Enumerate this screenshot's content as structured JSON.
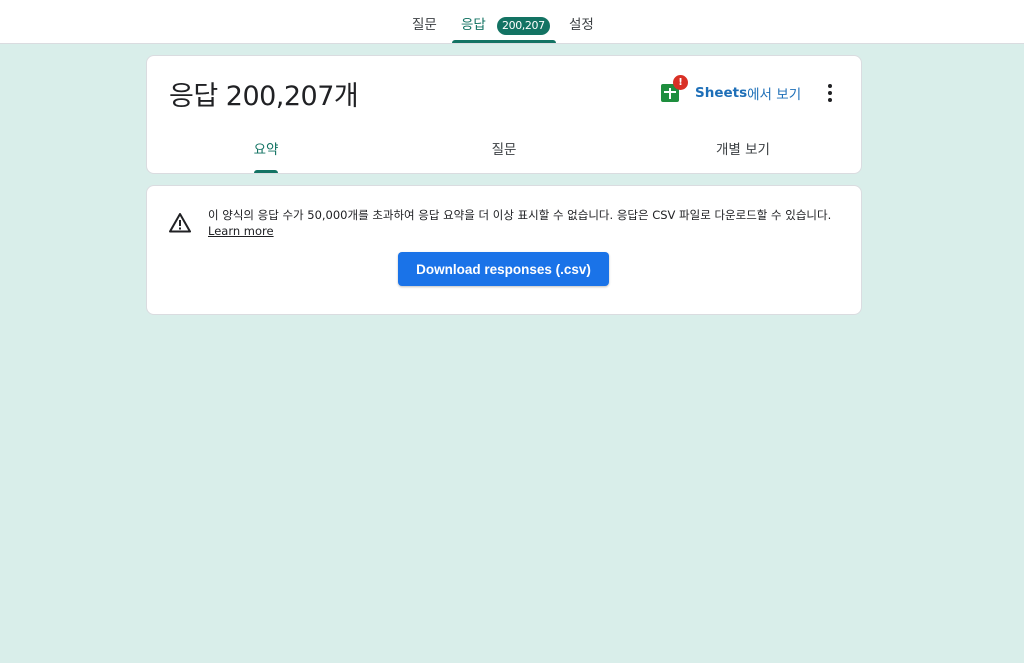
{
  "topnav": {
    "tabs": [
      {
        "label": "질문"
      },
      {
        "label": "응답",
        "badge": "200,207",
        "active": true
      },
      {
        "label": "설정"
      }
    ]
  },
  "header": {
    "title": "응답 200,207개",
    "sheets_link": {
      "brand": "Sheets",
      "suffix": "에서 보기",
      "alert": "!"
    },
    "subtabs": [
      {
        "label": "요약",
        "active": true
      },
      {
        "label": "질문"
      },
      {
        "label": "개별 보기"
      }
    ]
  },
  "notice": {
    "text": "이 양식의 응답 수가 50,000개를 초과하여 응답 요약을 더 이상 표시할 수 없습니다. 응답은 CSV 파일로 다운로드할 수 있습니다.",
    "learn_more": "Learn more",
    "download_label": "Download responses (.csv)"
  },
  "colors": {
    "background": "#d9eeea",
    "accent": "#137363",
    "primary_button": "#1a73e8",
    "link": "#1e6fb8",
    "alert": "#d93025"
  },
  "icons": [
    "sheets-icon",
    "alert-badge-icon",
    "more-vert-icon",
    "warning-icon"
  ]
}
